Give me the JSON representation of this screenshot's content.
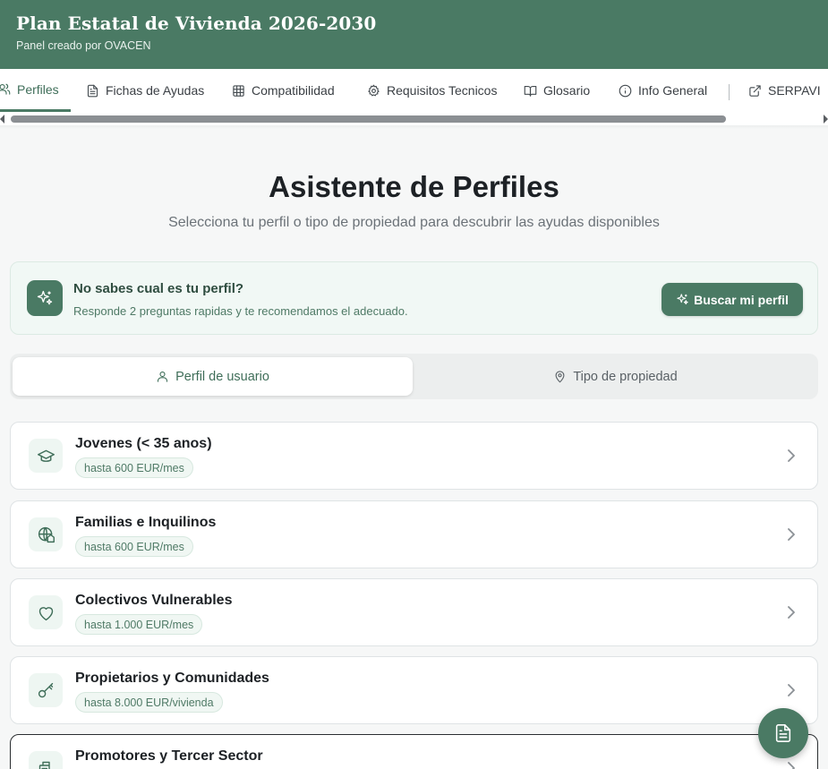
{
  "header": {
    "title": "Plan Estatal de Vivienda 2026-2030",
    "subtitle": "Panel creado por OVACEN"
  },
  "tabs": [
    {
      "label": "Perfiles",
      "icon": "users-icon",
      "active": true
    },
    {
      "label": "Fichas de Ayudas",
      "icon": "file-text-icon"
    },
    {
      "label": "Compatibilidad",
      "icon": "grid-icon"
    },
    {
      "label": "Requisitos Tecnicos",
      "icon": "gear-icon"
    },
    {
      "label": "Glosario",
      "icon": "book-open-icon"
    },
    {
      "label": "Info General",
      "icon": "info-icon"
    },
    {
      "label": "SERPAVI",
      "icon": "external-link-icon"
    }
  ],
  "main": {
    "title": "Asistente de Perfiles",
    "subtitle": "Selecciona tu perfil o tipo de propiedad para descubrir las ayudas disponibles"
  },
  "callout": {
    "title": "No sabes cual es tu perfil?",
    "text": "Responde 2 preguntas rapidas y te recomendamos el adecuado.",
    "button_label": "Buscar mi perfil"
  },
  "segment": {
    "user_label": "Perfil de usuario",
    "property_label": "Tipo de propiedad"
  },
  "profiles": [
    {
      "title": "Jovenes (< 35 anos)",
      "badge": "hasta 600 EUR/mes",
      "icon": "graduation-cap-icon"
    },
    {
      "title": "Familias e Inquilinos",
      "badge": "hasta 600 EUR/mes",
      "icon": "globe-house-icon"
    },
    {
      "title": "Colectivos Vulnerables",
      "badge": "hasta 1.000 EUR/mes",
      "icon": "heart-icon"
    },
    {
      "title": "Propietarios y Comunidades",
      "badge": "hasta 8.000 EUR/vivienda",
      "icon": "key-icon"
    },
    {
      "title": "Promotores y Tercer Sector",
      "badge": "",
      "icon": "building-icon"
    }
  ],
  "colors": {
    "brand": "#4a7a64",
    "brand_text": "#3f6e59",
    "callout_bg": "#f1f8f5"
  },
  "fab": {
    "icon": "document-icon"
  }
}
